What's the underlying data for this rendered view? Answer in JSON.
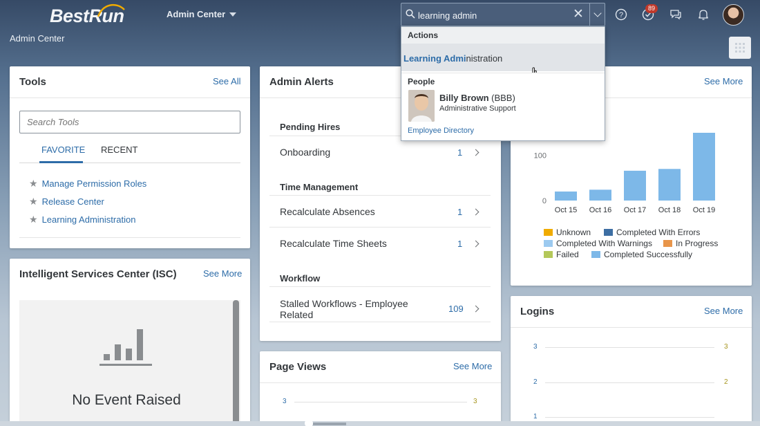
{
  "header": {
    "logo": "BestRun",
    "app_menu": "Admin Center",
    "page_title": "Admin Center",
    "notification_badge": "89",
    "search": {
      "value": "learning admin"
    }
  },
  "search_popup": {
    "actions_header": "Actions",
    "action_match": "Learning Admi",
    "action_rest": "nistration",
    "people_header": "People",
    "person_name": "Billy Brown",
    "person_id": "(BBB)",
    "person_role": "Administrative Support",
    "directory_link": "Employee Directory"
  },
  "tools": {
    "title": "Tools",
    "see_all": "See All",
    "search_placeholder": "Search Tools",
    "tabs": [
      "FAVORITE",
      "RECENT"
    ],
    "favorites": [
      "Manage Permission Roles",
      "Release Center",
      "Learning Administration"
    ]
  },
  "isc": {
    "title": "Intelligent Services Center (ISC)",
    "see_more": "See More",
    "empty_text": "No Event Raised"
  },
  "alerts": {
    "title": "Admin Alerts",
    "sections": [
      {
        "header": "Pending Hires",
        "rows": [
          {
            "label": "Onboarding",
            "count": "1"
          }
        ]
      },
      {
        "header": "Time Management",
        "rows": [
          {
            "label": "Recalculate Absences",
            "count": "1"
          },
          {
            "label": "Recalculate Time Sheets",
            "count": "1"
          }
        ]
      },
      {
        "header": "Workflow",
        "rows": [
          {
            "label": "Stalled Workflows - Employee Related",
            "count": "109"
          }
        ]
      }
    ]
  },
  "page_views": {
    "title": "Page Views",
    "see_more": "See More",
    "tick": "3",
    "tick_right": "3"
  },
  "jobs_card": {
    "see_more": "See More"
  },
  "logins": {
    "title": "Logins",
    "see_more": "See More",
    "ticks": [
      "3",
      "2",
      "1"
    ]
  },
  "chart_data": {
    "type": "bar",
    "categories": [
      "Oct 15",
      "Oct 16",
      "Oct 17",
      "Oct 18",
      "Oct 19"
    ],
    "values": [
      20,
      24,
      66,
      70,
      150
    ],
    "yticks": [
      "100",
      "0"
    ],
    "ylim": [
      0,
      150
    ],
    "legend": [
      {
        "name": "Unknown",
        "color": "#f0ab00"
      },
      {
        "name": "Completed With Errors",
        "color": "#3d6ea3"
      },
      {
        "name": "Completed With Warnings",
        "color": "#9ccaf0"
      },
      {
        "name": "In Progress",
        "color": "#e8954a"
      },
      {
        "name": "Failed",
        "color": "#b4c85a"
      },
      {
        "name": "Completed Successfully",
        "color": "#7db8e8"
      }
    ],
    "bar_color": "#7db8e8"
  }
}
